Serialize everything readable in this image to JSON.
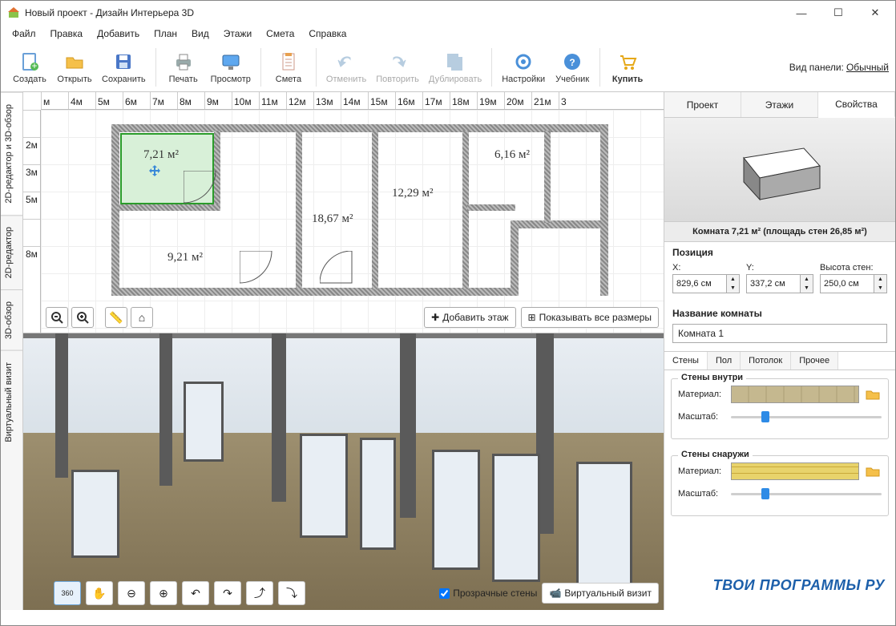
{
  "window": {
    "title": "Новый проект - Дизайн Интерьера 3D"
  },
  "menu": [
    "Файл",
    "Правка",
    "Добавить",
    "План",
    "Вид",
    "Этажи",
    "Смета",
    "Справка"
  ],
  "toolbar": {
    "create": "Создать",
    "open": "Открыть",
    "save": "Сохранить",
    "print": "Печать",
    "preview": "Просмотр",
    "estimate": "Смета",
    "undo": "Отменить",
    "redo": "Повторить",
    "duplicate": "Дублировать",
    "settings": "Настройки",
    "tutorial": "Учебник",
    "buy": "Купить"
  },
  "panel_mode": {
    "label": "Вид панели:",
    "value": "Обычный"
  },
  "left_tabs": [
    "2D-редактор и 3D-обзор",
    "2D-редактор",
    "3D-обзор",
    "Виртуальный визит"
  ],
  "ruler_h": [
    "м",
    "4м",
    "5м",
    "6м",
    "7м",
    "8м",
    "9м",
    "10м",
    "11м",
    "12м",
    "13м",
    "14м",
    "15м",
    "16м",
    "17м",
    "18м",
    "19м",
    "20м",
    "21м",
    "3"
  ],
  "ruler_v": [
    "",
    "2м",
    "3м",
    "5м",
    "",
    "8м"
  ],
  "rooms": {
    "r721": "7,21 м²",
    "r616": "6,16 м²",
    "r1229": "12,29 м²",
    "r1867": "18,67 м²",
    "r921": "9,21 м²"
  },
  "plan_actions": {
    "add_floor": "Добавить этаж",
    "show_dims": "Показывать все размеры"
  },
  "bottom": {
    "transparent": "Прозрачные стены",
    "virtual": "Виртуальный визит",
    "orbit": "360"
  },
  "ptabs": [
    "Проект",
    "Этажи",
    "Свойства"
  ],
  "room_info": "Комната 7,21 м²  (площадь стен 26,85 м²)",
  "pos": {
    "title": "Позиция",
    "x_lbl": "X:",
    "y_lbl": "Y:",
    "h_lbl": "Высота стен:",
    "x": "829,6 см",
    "y": "337,2 см",
    "h": "250,0 см"
  },
  "room_name": {
    "title": "Название комнаты",
    "value": "Комната 1"
  },
  "subtabs": [
    "Стены",
    "Пол",
    "Потолок",
    "Прочее"
  ],
  "walls_in": {
    "title": "Стены внутри",
    "material": "Материал:",
    "scale": "Масштаб:"
  },
  "walls_out": {
    "title": "Стены снаружи",
    "material": "Материал:",
    "scale": "Масштаб:"
  },
  "watermark": "ТВОИ ПРОГРАММЫ РУ"
}
